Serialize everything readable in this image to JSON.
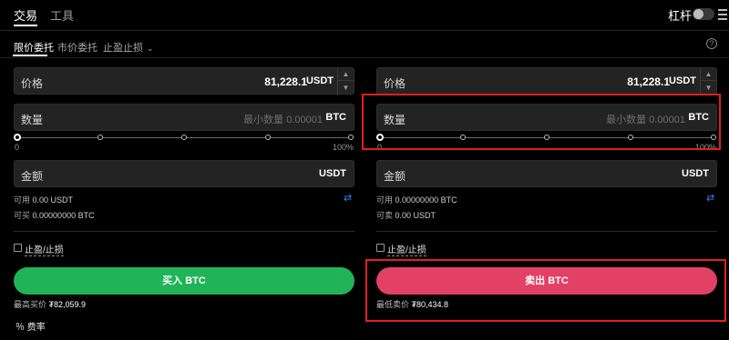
{
  "topbar": {
    "tabs": [
      {
        "label": "交易",
        "active": true
      },
      {
        "label": "工具",
        "active": false
      }
    ],
    "leverage_label": "杠杆",
    "leverage_toggle_on": false
  },
  "subtabs": [
    {
      "label": "限价委托",
      "active": true
    },
    {
      "label": "市价委托",
      "active": false
    },
    {
      "label": "止盈止损",
      "active": false,
      "dropdown": true
    }
  ],
  "help_icon": "question-circle-icon",
  "buy": {
    "price_label": "价格",
    "price_value": "81,228.1",
    "price_unit": "USDT",
    "qty_label": "数量",
    "qty_placeholder": "最小数量 0.00001",
    "qty_unit": "BTC",
    "slider_min": "0",
    "slider_max": "100%",
    "amount_label": "金额",
    "amount_unit": "USDT",
    "available_key": "可用",
    "available_value": "0.00 USDT",
    "can_buy_key": "可买",
    "can_buy_value": "0.00000000 BTC",
    "tpsl_label": "止盈/止损",
    "action_label": "买入 BTC",
    "best_key": "最高买价",
    "best_value": "₮82,059.9",
    "color": "#20b357"
  },
  "sell": {
    "price_label": "价格",
    "price_value": "81,228.1",
    "price_unit": "USDT",
    "qty_label": "数量",
    "qty_placeholder": "最小数量 0.00001",
    "qty_unit": "BTC",
    "slider_min": "0",
    "slider_max": "100%",
    "amount_label": "金额",
    "amount_unit": "USDT",
    "available_key": "可用",
    "available_value": "0.00000000 BTC",
    "can_sell_key": "可卖",
    "can_sell_value": "0.00 USDT",
    "tpsl_label": "止盈/止损",
    "action_label": "卖出 BTC",
    "best_key": "最低卖价",
    "best_value": "₮80,434.8",
    "color": "#e34065"
  },
  "fee_label": "％ 费率",
  "highlight_color": "#e02020"
}
